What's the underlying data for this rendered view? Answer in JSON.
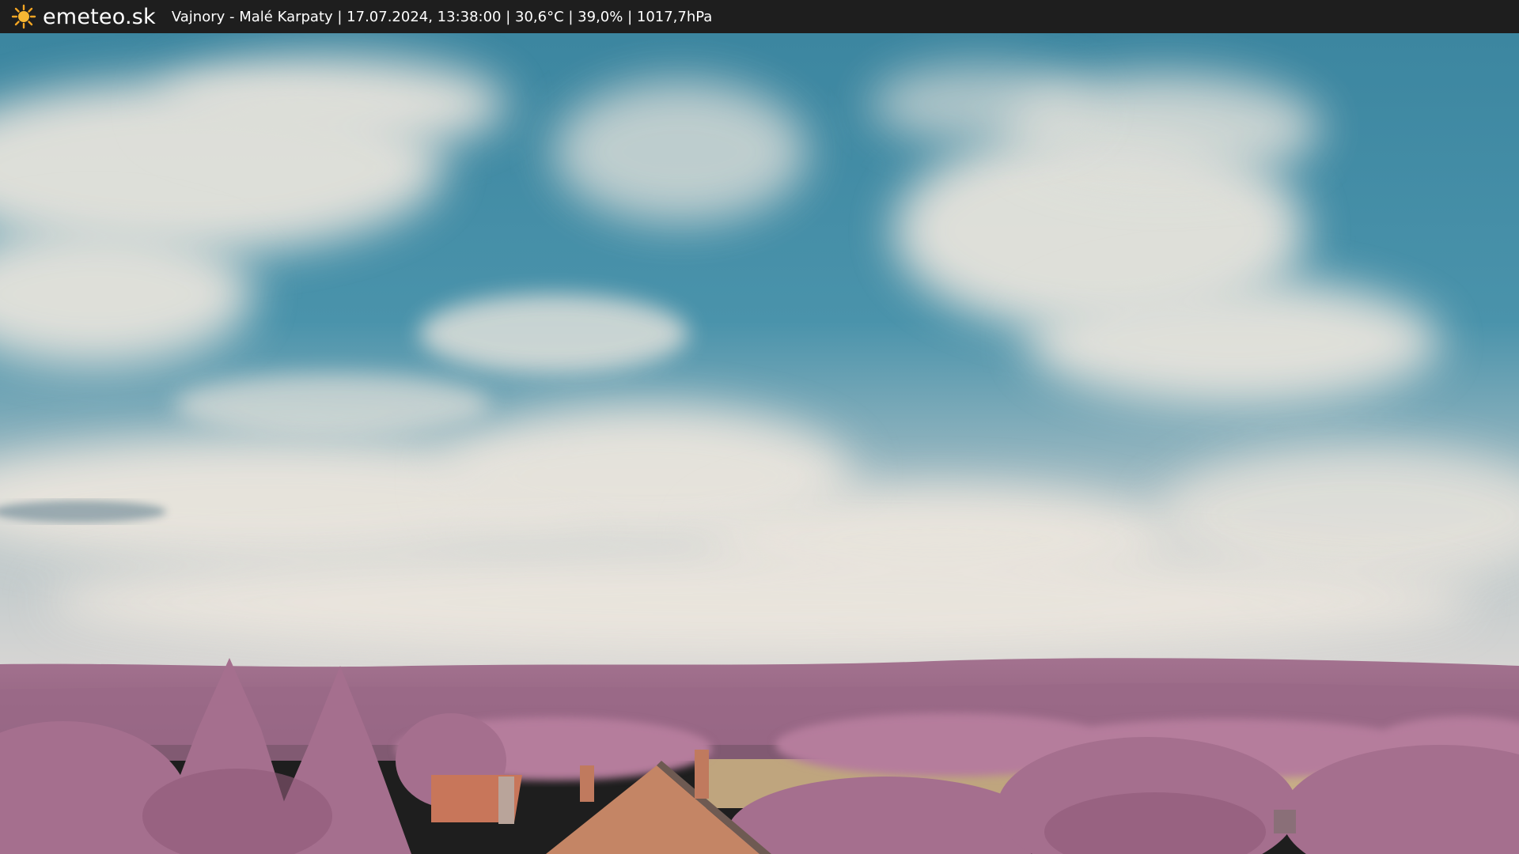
{
  "header": {
    "brand": "emeteo.sk",
    "caption": "Vajnory - Malé Karpaty | 17.07.2024, 13:38:00 | 30,6°C | 39,0% | 1017,7hPa",
    "icon": "sun-icon"
  },
  "colors": {
    "bar_background": "#1e1e1e",
    "sun": "#f5a623",
    "sky": "#3f8ea6",
    "cloud": "#e9e3dc",
    "foliage": "#a8708f",
    "field": "#bfa57e",
    "roof": "#c8765a"
  }
}
